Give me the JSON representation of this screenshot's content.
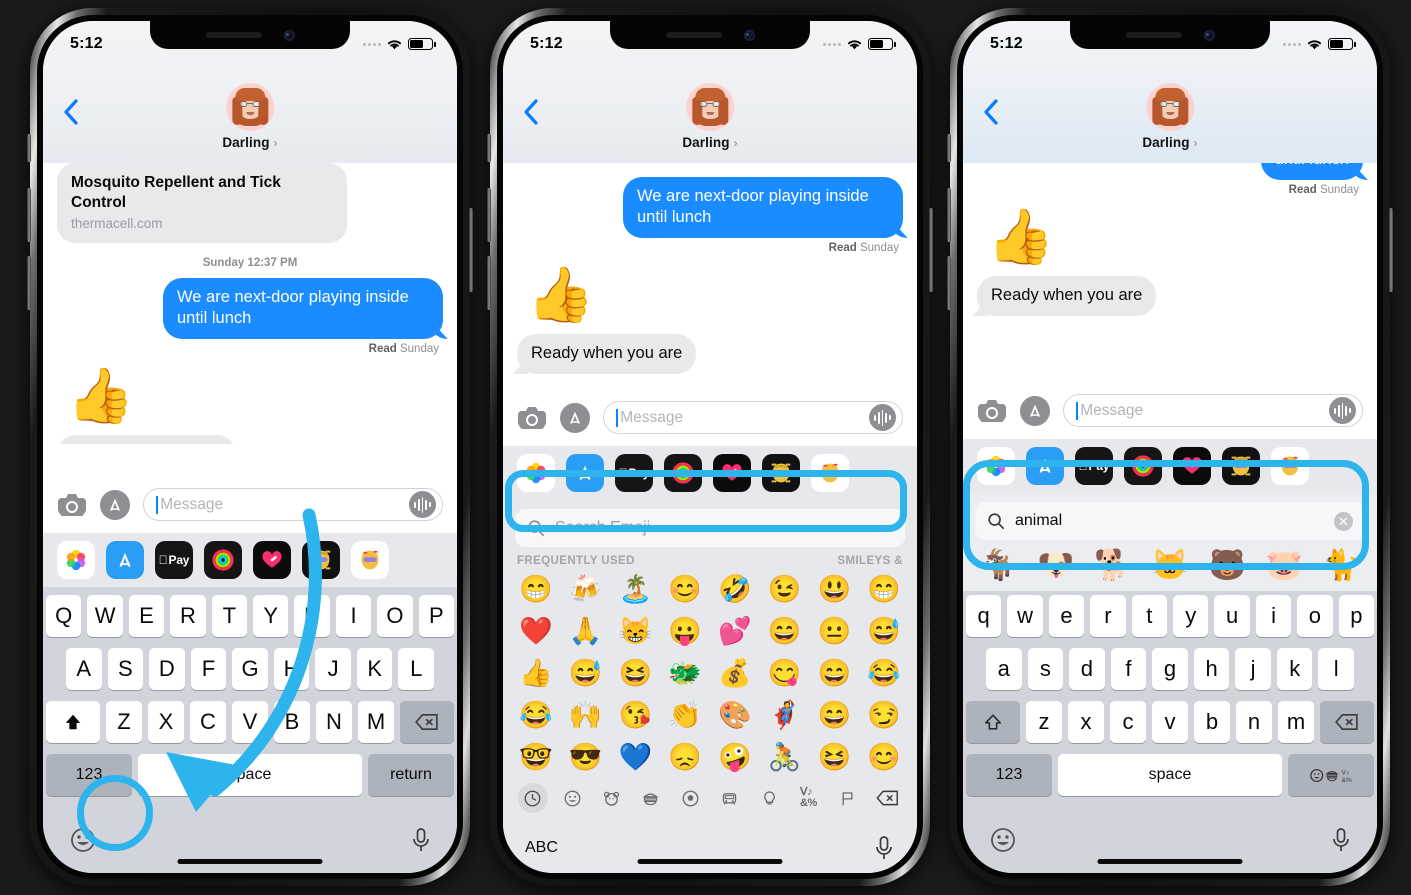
{
  "status": {
    "time": "5:12",
    "battery_pct": 62
  },
  "header": {
    "contact_name": "Darling",
    "chevron": "›"
  },
  "conversation": {
    "link_card": {
      "title": "Mosquito Repellent and Tick Control",
      "url": "thermacell.com"
    },
    "daystamp": "Sunday 12:37 PM",
    "outgoing_message": "We are next-door playing inside until lunch",
    "outgoing_message_truncated": "until lunch",
    "read_label": "Read",
    "read_day": "Sunday",
    "reaction_emoji": "👍",
    "incoming_message": "Ready when you are"
  },
  "input_bar": {
    "placeholder": "Message",
    "camera_icon": "camera-icon",
    "appstore_icon": "appstore-icon",
    "audio_icon": "audio-waveform-icon"
  },
  "app_drawer": [
    {
      "name": "photos-app",
      "label": "Photos"
    },
    {
      "name": "appstore-app",
      "label": "App Store"
    },
    {
      "name": "apple-pay-app",
      "label": "Pay"
    },
    {
      "name": "activity-app",
      "label": "Activity"
    },
    {
      "name": "health-app",
      "label": "Health"
    },
    {
      "name": "memoji-app-1",
      "label": "Memoji"
    },
    {
      "name": "memoji-app-2",
      "label": "Memoji"
    }
  ],
  "keyboard_upper": {
    "row1": [
      "Q",
      "W",
      "E",
      "R",
      "T",
      "Y",
      "U",
      "I",
      "O",
      "P"
    ],
    "row2": [
      "A",
      "S",
      "D",
      "F",
      "G",
      "H",
      "J",
      "K",
      "L"
    ],
    "row3": [
      "Z",
      "X",
      "C",
      "V",
      "B",
      "N",
      "M"
    ],
    "shift_icon": "shift-icon",
    "delete_icon": "backspace-icon",
    "numbers_key": "123",
    "space_key": "space",
    "return_key": "return",
    "emoji_key_icon": "emoji-smiley-icon",
    "mic_icon": "microphone-icon"
  },
  "keyboard_lower": {
    "row1": [
      "q",
      "w",
      "e",
      "r",
      "t",
      "y",
      "u",
      "i",
      "o",
      "p"
    ],
    "row2": [
      "a",
      "s",
      "d",
      "f",
      "g",
      "h",
      "j",
      "k",
      "l"
    ],
    "row3": [
      "z",
      "x",
      "c",
      "v",
      "b",
      "n",
      "m"
    ],
    "shift_icon": "shift-outline-icon",
    "delete_icon": "backspace-icon",
    "numbers_key": "123",
    "space_key": "space",
    "emoji_category_key": "😀🍔〒",
    "emoji_key_icon": "emoji-smiley-icon",
    "mic_icon": "microphone-icon"
  },
  "emoji_panel": {
    "search_placeholder": "Search Emoji",
    "search_icon": "magnifier-icon",
    "section_left": "FREQUENTLY USED",
    "section_right": "SMILEYS &",
    "grid": [
      "😁",
      "🍻",
      "🏝️",
      "😊",
      "🤣",
      "😉",
      "😃",
      "😁",
      "❤️",
      "🙏",
      "😸",
      "😛",
      "💕",
      "😄",
      "😐",
      "😅",
      "👍",
      "😅",
      "😆",
      "🐲",
      "💰",
      "😋",
      "😄",
      "😂",
      "😂",
      "🙌",
      "😘",
      "👏",
      "🎨",
      "🦸",
      "😄",
      "😏",
      "🤓",
      "😎",
      "💙",
      "😞",
      "🤪",
      "🚴",
      "😆",
      "😊"
    ],
    "categories": [
      {
        "name": "recent-category",
        "glyph": "🕒",
        "active": true
      },
      {
        "name": "smileys-category",
        "glyph": "😀",
        "active": false
      },
      {
        "name": "animals-category",
        "glyph": "🐻",
        "active": false
      },
      {
        "name": "food-category",
        "glyph": "🍔",
        "active": false
      },
      {
        "name": "activity-category",
        "glyph": "⚽",
        "active": false
      },
      {
        "name": "travel-category",
        "glyph": "🚗",
        "active": false
      },
      {
        "name": "objects-category",
        "glyph": "💡",
        "active": false
      },
      {
        "name": "symbols-category",
        "glyph": "〒",
        "active": false
      },
      {
        "name": "flags-category",
        "glyph": "🏳️",
        "active": false
      },
      {
        "name": "delete-key",
        "glyph": "⌫",
        "active": false
      }
    ],
    "abc_key": "ABC",
    "mic_icon": "microphone-icon"
  },
  "emoji_search_results": {
    "query": "animal",
    "clear_icon": "clear-circle-icon",
    "results": [
      "🐐",
      "🐶",
      "🐕",
      "🐱",
      "🐻",
      "🐷",
      "🐈"
    ]
  },
  "annotations": {
    "highlight_color": "#2db4ec",
    "phone1_target": "emoji-key-highlight",
    "phone2_target": "search-emoji-field-highlight",
    "phone3_target": "search-results-highlight"
  }
}
